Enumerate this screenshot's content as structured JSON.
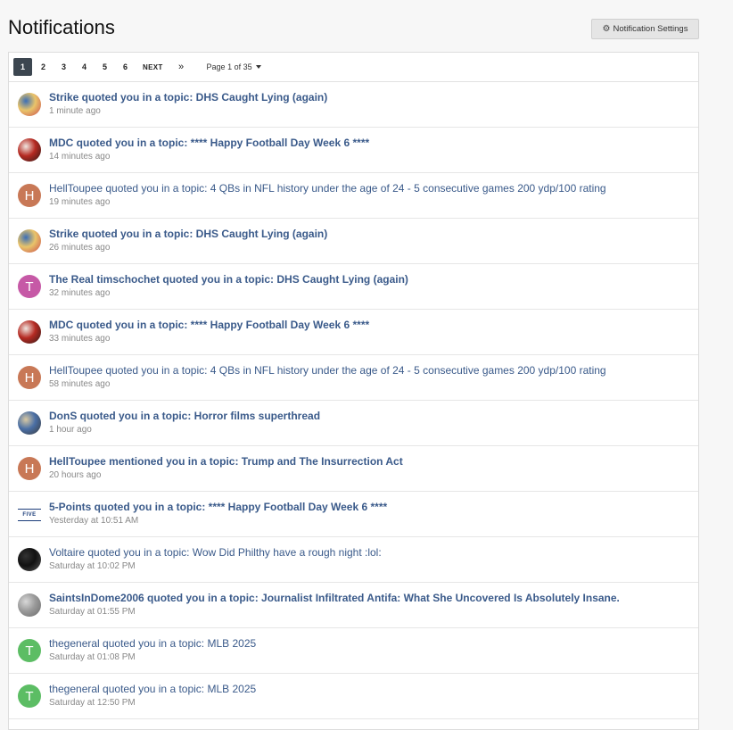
{
  "header": {
    "title": "Notifications",
    "settings_label": "Notification Settings",
    "settings_icon": "gear-icon"
  },
  "pagination": {
    "pages": [
      "1",
      "2",
      "3",
      "4",
      "5",
      "6"
    ],
    "current": "1",
    "next_label": "NEXT",
    "last_label": "»",
    "page_info": "Page 1 of 35"
  },
  "notifications": [
    {
      "text": "Strike quoted you in a topic: DHS Caught Lying (again)",
      "time": "1 minute ago",
      "unread": true,
      "avatar": {
        "type": "image",
        "colors": [
          "#e9c46a",
          "#3b6fb6",
          "#c94c4c"
        ]
      }
    },
    {
      "text": "MDC quoted you in a topic: **** Happy Football Day Week 6 ****",
      "time": "14 minutes ago",
      "unread": true,
      "avatar": {
        "type": "image",
        "colors": [
          "#b52a22",
          "#f0e6e0",
          "#2a1a18"
        ]
      }
    },
    {
      "text": "HellToupee quoted you in a topic: 4 QBs in NFL history under the age of 24 - 5 consecutive games 200 ydp/100 rating",
      "time": "19 minutes ago",
      "unread": false,
      "avatar": {
        "type": "letter",
        "letter": "H",
        "color": "#c87856"
      }
    },
    {
      "text": "Strike quoted you in a topic: DHS Caught Lying (again)",
      "time": "26 minutes ago",
      "unread": true,
      "avatar": {
        "type": "image",
        "colors": [
          "#e9c46a",
          "#3b6fb6",
          "#c94c4c"
        ]
      }
    },
    {
      "text": "The Real timschochet quoted you in a topic: DHS Caught Lying (again)",
      "time": "32 minutes ago",
      "unread": true,
      "avatar": {
        "type": "letter",
        "letter": "T",
        "color": "#c659a6"
      }
    },
    {
      "text": "MDC quoted you in a topic: **** Happy Football Day Week 6 ****",
      "time": "33 minutes ago",
      "unread": true,
      "avatar": {
        "type": "image",
        "colors": [
          "#b52a22",
          "#f0e6e0",
          "#2a1a18"
        ]
      }
    },
    {
      "text": "HellToupee quoted you in a topic: 4 QBs in NFL history under the age of 24 - 5 consecutive games 200 ydp/100 rating",
      "time": "58 minutes ago",
      "unread": false,
      "avatar": {
        "type": "letter",
        "letter": "H",
        "color": "#c87856"
      }
    },
    {
      "text": "DonS quoted you in a topic: Horror films superthread",
      "time": "1 hour ago",
      "unread": true,
      "avatar": {
        "type": "image",
        "colors": [
          "#4a6fa5",
          "#d9c9a3",
          "#3a3a3a"
        ]
      }
    },
    {
      "text": "HellToupee mentioned you in a topic: Trump and The Insurrection Act",
      "time": "20 hours ago",
      "unread": true,
      "avatar": {
        "type": "letter",
        "letter": "H",
        "color": "#c87856"
      }
    },
    {
      "text": "5-Points quoted you in a topic: **** Happy Football Day Week 6 ****",
      "time": "Yesterday at 10:51 AM",
      "unread": true,
      "avatar": {
        "type": "logo",
        "text": "FIVE"
      }
    },
    {
      "text": "Voltaire quoted you in a topic: Wow Did Philthy have a rough night :lol:",
      "time": "Saturday at 10:02 PM",
      "unread": false,
      "avatar": {
        "type": "image",
        "colors": [
          "#111111",
          "#333333",
          "#555555"
        ]
      }
    },
    {
      "text": "SaintsInDome2006 quoted you in a topic: Journalist Infiltrated Antifa: What She Uncovered Is Absolutely Insane.",
      "time": "Saturday at 01:55 PM",
      "unread": true,
      "avatar": {
        "type": "image",
        "colors": [
          "#9a9a9a",
          "#d8d8d8",
          "#6a6a6a"
        ]
      }
    },
    {
      "text": "thegeneral quoted you in a topic: MLB 2025",
      "time": "Saturday at 01:08 PM",
      "unread": false,
      "avatar": {
        "type": "letter",
        "letter": "T",
        "color": "#5cbd64"
      }
    },
    {
      "text": "thegeneral quoted you in a topic: MLB 2025",
      "time": "Saturday at 12:50 PM",
      "unread": false,
      "avatar": {
        "type": "letter",
        "letter": "T",
        "color": "#5cbd64"
      }
    }
  ]
}
